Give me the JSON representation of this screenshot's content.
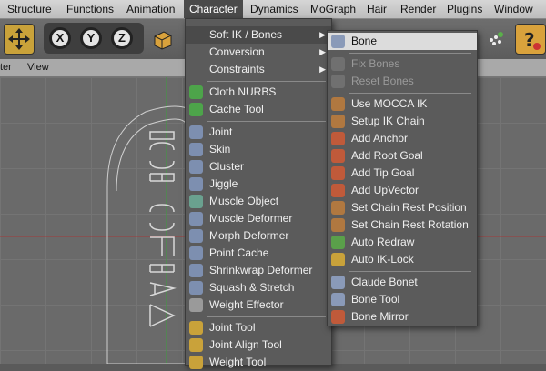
{
  "menubar": {
    "items": [
      "Structure",
      "Functions",
      "Animation",
      "Character",
      "Dynamics",
      "MoGraph",
      "Hair",
      "Render",
      "Plugins",
      "Window"
    ]
  },
  "viewheader": {
    "items": [
      "ter",
      "View"
    ]
  },
  "character_menu": {
    "items": [
      {
        "label": "Soft IK / Bones",
        "submenu": true
      },
      {
        "label": "Conversion",
        "submenu": true
      },
      {
        "label": "Constraints",
        "submenu": true
      },
      {
        "label": "Cloth NURBS"
      },
      {
        "label": "Cache Tool"
      },
      {
        "label": "Joint"
      },
      {
        "label": "Skin"
      },
      {
        "label": "Cluster"
      },
      {
        "label": "Jiggle"
      },
      {
        "label": "Muscle Object"
      },
      {
        "label": "Muscle Deformer"
      },
      {
        "label": "Morph Deformer"
      },
      {
        "label": "Point Cache"
      },
      {
        "label": "Shrinkwrap Deformer"
      },
      {
        "label": "Squash & Stretch"
      },
      {
        "label": "Weight Effector"
      },
      {
        "label": "Joint Tool"
      },
      {
        "label": "Joint Align Tool"
      },
      {
        "label": "Weight Tool"
      }
    ]
  },
  "softik_submenu": {
    "items": [
      {
        "label": "Bone"
      },
      {
        "label": "Fix Bones",
        "disabled": true
      },
      {
        "label": "Reset Bones",
        "disabled": true
      },
      {
        "label": "Use MOCCA IK"
      },
      {
        "label": "Setup IK Chain"
      },
      {
        "label": "Add Anchor"
      },
      {
        "label": "Add Root Goal"
      },
      {
        "label": "Add Tip Goal"
      },
      {
        "label": "Add UpVector"
      },
      {
        "label": "Set Chain Rest Position"
      },
      {
        "label": "Set Chain Rest Rotation"
      },
      {
        "label": "Auto Redraw"
      },
      {
        "label": "Auto IK-Lock"
      },
      {
        "label": "Claude Bonet"
      },
      {
        "label": "Bone Tool"
      },
      {
        "label": "Bone Mirror"
      }
    ]
  },
  "toolbar": {
    "x_label": "X",
    "y_label": "Y",
    "z_label": "Z"
  },
  "colors": {
    "menu_bg": "#5b5b5b",
    "highlight": "#dcdcdc",
    "active_menu": "#4a4a4a"
  }
}
